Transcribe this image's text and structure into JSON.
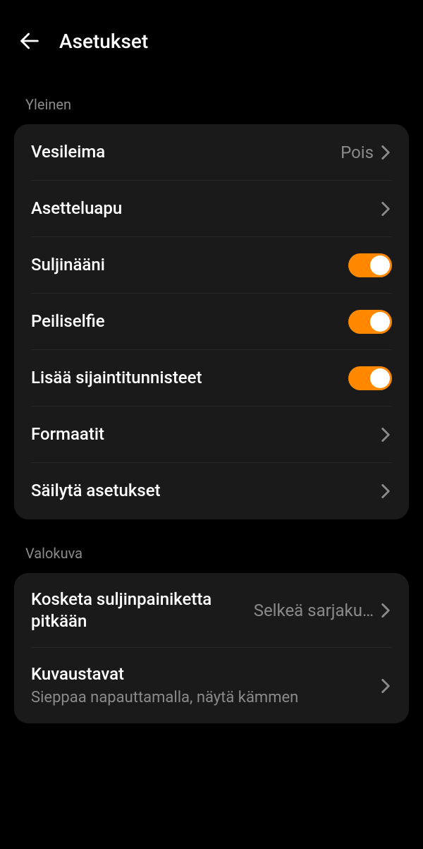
{
  "header": {
    "title": "Asetukset"
  },
  "sections": {
    "general": {
      "label": "Yleinen",
      "watermark": {
        "title": "Vesileima",
        "value": "Pois"
      },
      "composition_guide": {
        "title": "Asetteluapu"
      },
      "shutter_sound": {
        "title": "Suljinääni",
        "on": true
      },
      "mirror_selfie": {
        "title": "Peiliselfie",
        "on": true
      },
      "location_tags": {
        "title": "Lisää sijaintitunnisteet",
        "on": true
      },
      "formats": {
        "title": "Formaatit"
      },
      "retain_settings": {
        "title": "Säilytä asetukset"
      }
    },
    "photo": {
      "label": "Valokuva",
      "long_press_shutter": {
        "title": "Kosketa suljinpainiketta pitkään",
        "value": "Selkeä sarjaku…"
      },
      "capture_methods": {
        "title": "Kuvaustavat",
        "subtitle": "Sieppaa napauttamalla, näytä kämmen"
      }
    }
  }
}
